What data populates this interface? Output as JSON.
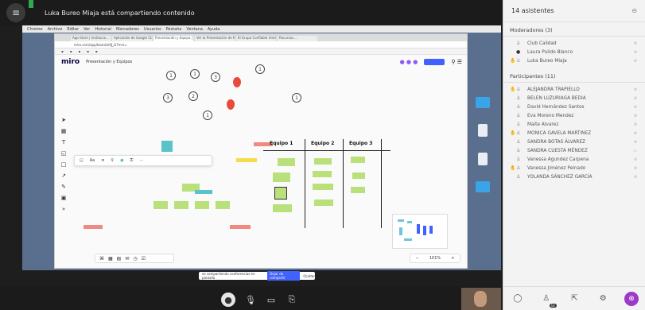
{
  "call": {
    "share_title": "Luka Bureo Miaja está compartiendo contenido",
    "screen_share_notice": "se compartiendo conferencias en pantalla",
    "stop_sharing": "Dejar de compartir",
    "hide": "Ocultar"
  },
  "browser": {
    "mac_menu": [
      "Chrome",
      "Archivo",
      "Editar",
      "Ver",
      "Historial",
      "Marcadores",
      "Usuarios",
      "Pestaña",
      "Ventana",
      "Ayuda"
    ],
    "tabs": [
      "App-Store | Institucio...",
      "Aplicación de Google Classroom",
      "Presentación y Equipo | Mi...",
      "Ver la Presentación de ME...",
      "El Grupo Confiable Unidos",
      "Recursos..."
    ],
    "url": "miro.com/app/board/o9J_lz7mrs="
  },
  "miro": {
    "logo": "miro",
    "board_title": "Presentación y Equipos",
    "team_headers": [
      "Equipo 1",
      "Equipo 2",
      "Equipo 3"
    ],
    "zoom": "101%",
    "circle_numbers": [
      "1",
      "1",
      "3",
      "1",
      "3",
      "2",
      "1",
      "1"
    ]
  },
  "panel": {
    "title": "14 asistentes",
    "moderators_title": "Moderadores (3)",
    "moderators": [
      {
        "name": "Club Calidad",
        "hand": false
      },
      {
        "name": "Laura Pulido Blanco",
        "hand": false
      },
      {
        "name": "Luka Bureo Miaja",
        "hand": true
      }
    ],
    "participants_title": "Participantes (11)",
    "participants": [
      {
        "name": "ALEJANDRA TRAPIELLO",
        "hand": true
      },
      {
        "name": "BELEN LUZURIAGA BEDIA",
        "hand": false
      },
      {
        "name": "David Hernández Santos",
        "hand": false
      },
      {
        "name": "Eva Moreno Mendez",
        "hand": false
      },
      {
        "name": "Maite Alvarez",
        "hand": false
      },
      {
        "name": "MONICA GAVELA MARTINEZ",
        "hand": true
      },
      {
        "name": "SANDRA BOTAS ÁLVAREZ",
        "hand": false
      },
      {
        "name": "SANDRA CUESTA MÉNDEZ",
        "hand": false
      },
      {
        "name": "Vanessa Agundez Carpena",
        "hand": false
      },
      {
        "name": "Vanessa Jiménez Peinado",
        "hand": true
      },
      {
        "name": "YOLANDA SÁNCHEZ GARCÍA",
        "hand": false
      }
    ],
    "attendee_badge": "14"
  },
  "icons": {
    "menu": "hamburger-menu-icon",
    "hand": "raised-hand-icon",
    "user": "user-icon",
    "mic": "microphone-off-icon",
    "camera": "camera-off-icon",
    "share": "share-screen-icon",
    "chat": "chat-icon",
    "participants": "participants-icon",
    "reactions": "reactions-icon",
    "settings": "gear-icon",
    "close": "close-icon"
  },
  "colors": {
    "miro_blue": "#4262ff",
    "balloon_red": "#e84a3c",
    "sticky_green": "#b9e07a",
    "reaction_purple": "#9b39c8"
  }
}
